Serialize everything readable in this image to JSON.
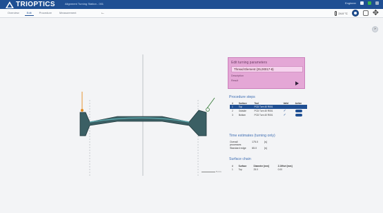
{
  "app": {
    "logo": "TRIOPTICS",
    "window_title": "Alignment Turning Station - 001",
    "user": "Engineer",
    "temperature": "24.0 °C"
  },
  "tabs": [
    {
      "label": "Overview",
      "active": false
    },
    {
      "label": "Edit",
      "active": true
    },
    {
      "label": "Procedure",
      "active": false
    },
    {
      "label": "Measurement",
      "active": false
    }
  ],
  "turning_card": {
    "title": "Edit turning parameters",
    "lens_name": "Thread Element (25,00017-8)",
    "label1": "Description",
    "label2": "Result"
  },
  "procedure_steps": {
    "title": "Procedure steps",
    "headers": [
      "#",
      "Surface",
      "Tool",
      "Valid",
      "Active"
    ],
    "rows": [
      {
        "n": "1",
        "surface": "Top",
        "tool": "PCD Turn 40 R001",
        "valid": "",
        "active": "toggle",
        "selected": true
      },
      {
        "n": "2",
        "surface": "Outside",
        "tool": "PCD Turn 40 R001",
        "valid": "✓",
        "active": "toggle",
        "selected": false
      },
      {
        "n": "3",
        "surface": "Bottom",
        "tool": "PCD Turn 40 R001",
        "valid": "✓",
        "active": "toggle",
        "selected": false
      }
    ]
  },
  "time_estimate": {
    "title": "Time estimates (turning only)",
    "rows": [
      {
        "label": "Overall processes",
        "value": "175.0",
        "unit": "[s]"
      },
      {
        "label": "Standard edge",
        "value": "65.0",
        "unit": "[s]"
      }
    ]
  },
  "surface_chain": {
    "title": "Surface chain",
    "headers": [
      "#",
      "Surface",
      "Diameter [mm]",
      "Z-Offset [mm]"
    ],
    "rows": [
      {
        "n": "1",
        "surface": "Top",
        "diameter": "25.0",
        "offset": "0.00"
      }
    ]
  },
  "scale_label": "5 mm",
  "colors": {
    "header": "#1f4f93",
    "lens": "#3b5f64",
    "card": "#e4a7d6"
  }
}
